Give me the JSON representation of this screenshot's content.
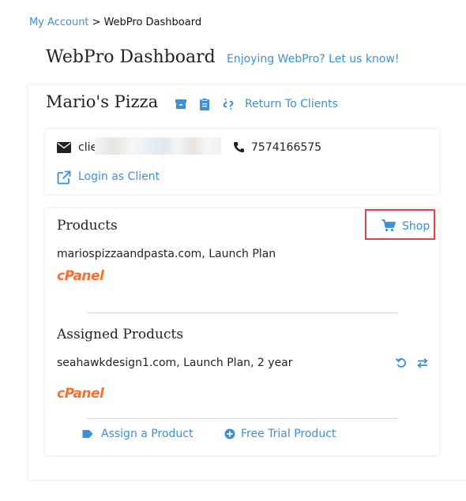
{
  "breadcrumb": {
    "parent": "My Account",
    "separator": ">",
    "current": "WebPro Dashboard"
  },
  "header": {
    "title": "WebPro Dashboard",
    "feedback_link": "Enjoying WebPro? Let us know!"
  },
  "client": {
    "name": "Mario's Pizza",
    "icons": [
      "archive-icon",
      "clipboard-icon",
      "unlink-icon"
    ],
    "return_link": "Return To Clients",
    "email_visible": "clie",
    "phone": "7574166575",
    "login_link": "Login as Client"
  },
  "products": {
    "title": "Products",
    "shop_label": "Shop",
    "items": [
      {
        "name": "mariospizzaandpasta.com, Launch Plan",
        "panel": "cPanel"
      }
    ]
  },
  "assigned": {
    "title": "Assigned Products",
    "items": [
      {
        "name": "seahawkdesign1.com, Launch Plan, 2 year",
        "panel": "cPanel"
      }
    ],
    "assign_link": "Assign a Product",
    "trial_link": "Free Trial Product"
  },
  "colors": {
    "link": "#3d8fd6",
    "highlight": "#e0434b",
    "cpanel": "#ff6c2c"
  }
}
